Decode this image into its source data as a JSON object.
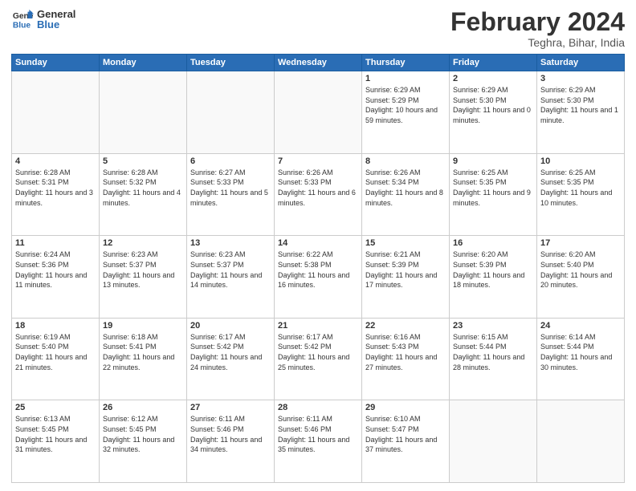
{
  "logo": {
    "general": "General",
    "blue": "Blue"
  },
  "header": {
    "month_year": "February 2024",
    "location": "Teghra, Bihar, India"
  },
  "weekdays": [
    "Sunday",
    "Monday",
    "Tuesday",
    "Wednesday",
    "Thursday",
    "Friday",
    "Saturday"
  ],
  "weeks": [
    [
      {
        "day": "",
        "empty": true
      },
      {
        "day": "",
        "empty": true
      },
      {
        "day": "",
        "empty": true
      },
      {
        "day": "",
        "empty": true
      },
      {
        "day": "1",
        "sunrise": "6:29 AM",
        "sunset": "5:29 PM",
        "daylight": "10 hours and 59 minutes."
      },
      {
        "day": "2",
        "sunrise": "6:29 AM",
        "sunset": "5:30 PM",
        "daylight": "11 hours and 0 minutes."
      },
      {
        "day": "3",
        "sunrise": "6:29 AM",
        "sunset": "5:30 PM",
        "daylight": "11 hours and 1 minute."
      }
    ],
    [
      {
        "day": "4",
        "sunrise": "6:28 AM",
        "sunset": "5:31 PM",
        "daylight": "11 hours and 3 minutes."
      },
      {
        "day": "5",
        "sunrise": "6:28 AM",
        "sunset": "5:32 PM",
        "daylight": "11 hours and 4 minutes."
      },
      {
        "day": "6",
        "sunrise": "6:27 AM",
        "sunset": "5:33 PM",
        "daylight": "11 hours and 5 minutes."
      },
      {
        "day": "7",
        "sunrise": "6:26 AM",
        "sunset": "5:33 PM",
        "daylight": "11 hours and 6 minutes."
      },
      {
        "day": "8",
        "sunrise": "6:26 AM",
        "sunset": "5:34 PM",
        "daylight": "11 hours and 8 minutes."
      },
      {
        "day": "9",
        "sunrise": "6:25 AM",
        "sunset": "5:35 PM",
        "daylight": "11 hours and 9 minutes."
      },
      {
        "day": "10",
        "sunrise": "6:25 AM",
        "sunset": "5:35 PM",
        "daylight": "11 hours and 10 minutes."
      }
    ],
    [
      {
        "day": "11",
        "sunrise": "6:24 AM",
        "sunset": "5:36 PM",
        "daylight": "11 hours and 11 minutes."
      },
      {
        "day": "12",
        "sunrise": "6:23 AM",
        "sunset": "5:37 PM",
        "daylight": "11 hours and 13 minutes."
      },
      {
        "day": "13",
        "sunrise": "6:23 AM",
        "sunset": "5:37 PM",
        "daylight": "11 hours and 14 minutes."
      },
      {
        "day": "14",
        "sunrise": "6:22 AM",
        "sunset": "5:38 PM",
        "daylight": "11 hours and 16 minutes."
      },
      {
        "day": "15",
        "sunrise": "6:21 AM",
        "sunset": "5:39 PM",
        "daylight": "11 hours and 17 minutes."
      },
      {
        "day": "16",
        "sunrise": "6:20 AM",
        "sunset": "5:39 PM",
        "daylight": "11 hours and 18 minutes."
      },
      {
        "day": "17",
        "sunrise": "6:20 AM",
        "sunset": "5:40 PM",
        "daylight": "11 hours and 20 minutes."
      }
    ],
    [
      {
        "day": "18",
        "sunrise": "6:19 AM",
        "sunset": "5:40 PM",
        "daylight": "11 hours and 21 minutes."
      },
      {
        "day": "19",
        "sunrise": "6:18 AM",
        "sunset": "5:41 PM",
        "daylight": "11 hours and 22 minutes."
      },
      {
        "day": "20",
        "sunrise": "6:17 AM",
        "sunset": "5:42 PM",
        "daylight": "11 hours and 24 minutes."
      },
      {
        "day": "21",
        "sunrise": "6:17 AM",
        "sunset": "5:42 PM",
        "daylight": "11 hours and 25 minutes."
      },
      {
        "day": "22",
        "sunrise": "6:16 AM",
        "sunset": "5:43 PM",
        "daylight": "11 hours and 27 minutes."
      },
      {
        "day": "23",
        "sunrise": "6:15 AM",
        "sunset": "5:44 PM",
        "daylight": "11 hours and 28 minutes."
      },
      {
        "day": "24",
        "sunrise": "6:14 AM",
        "sunset": "5:44 PM",
        "daylight": "11 hours and 30 minutes."
      }
    ],
    [
      {
        "day": "25",
        "sunrise": "6:13 AM",
        "sunset": "5:45 PM",
        "daylight": "11 hours and 31 minutes."
      },
      {
        "day": "26",
        "sunrise": "6:12 AM",
        "sunset": "5:45 PM",
        "daylight": "11 hours and 32 minutes."
      },
      {
        "day": "27",
        "sunrise": "6:11 AM",
        "sunset": "5:46 PM",
        "daylight": "11 hours and 34 minutes."
      },
      {
        "day": "28",
        "sunrise": "6:11 AM",
        "sunset": "5:46 PM",
        "daylight": "11 hours and 35 minutes."
      },
      {
        "day": "29",
        "sunrise": "6:10 AM",
        "sunset": "5:47 PM",
        "daylight": "11 hours and 37 minutes."
      },
      {
        "day": "",
        "empty": true
      },
      {
        "day": "",
        "empty": true
      }
    ]
  ]
}
